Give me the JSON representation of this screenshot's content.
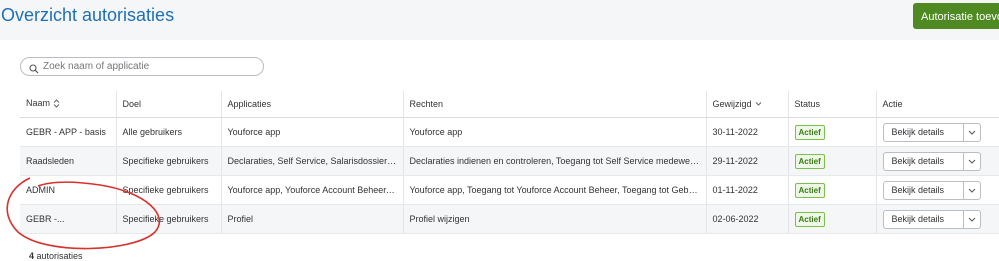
{
  "header": {
    "title": "Overzicht autorisaties",
    "add_button": "Autorisatie toevoegen"
  },
  "search": {
    "placeholder": "Zoek naam of applicatie",
    "value": ""
  },
  "table": {
    "columns": [
      "Naam",
      "Doel",
      "Applicaties",
      "Rechten",
      "Gewijzigd",
      "Status",
      "Actie"
    ],
    "rows": [
      {
        "naam": "GEBR - APP - basis",
        "doel": "Alle gebruikers",
        "applicaties": "Youforce app",
        "rechten": "Youforce app",
        "gewijzigd": "30-11-2022",
        "status": "Actief",
        "actie": "Bekijk details"
      },
      {
        "naam": "Raadsleden",
        "doel": "Specifieke gebruikers",
        "applicaties": "Declaraties, Self Service, Salarisdossier - E-...",
        "rechten": "Declaraties indienen en controleren, Toegang tot Self Service medewerker, Instellen...",
        "gewijzigd": "29-11-2022",
        "status": "Actief",
        "actie": "Bekijk details"
      },
      {
        "naam": "ADMIN",
        "doel": "Specifieke gebruikers",
        "applicaties": "Youforce app, Youforce Account Beheer, Export...",
        "rechten": "Youforce app, Toegang tot Youforce Account Beheer, Toegang tot Gebruikersbehee...",
        "gewijzigd": "01-11-2022",
        "status": "Actief",
        "actie": "Bekijk details"
      },
      {
        "naam": "GEBR -...",
        "doel": "Specifieke gebruikers",
        "applicaties": "Profiel",
        "rechten": "Profiel wijzigen",
        "gewijzigd": "02-06-2022",
        "status": "Actief",
        "actie": "Bekijk details"
      }
    ]
  },
  "footer": {
    "count": "4",
    "label": "autorisaties"
  },
  "colors": {
    "title": "#1f6fb5",
    "button": "#4e8a21",
    "badge": "#3b7a17",
    "annotation": "#d9312b"
  },
  "icons": [
    "search-icon",
    "sort-icon",
    "sort-down-icon",
    "chevron-down-icon"
  ]
}
